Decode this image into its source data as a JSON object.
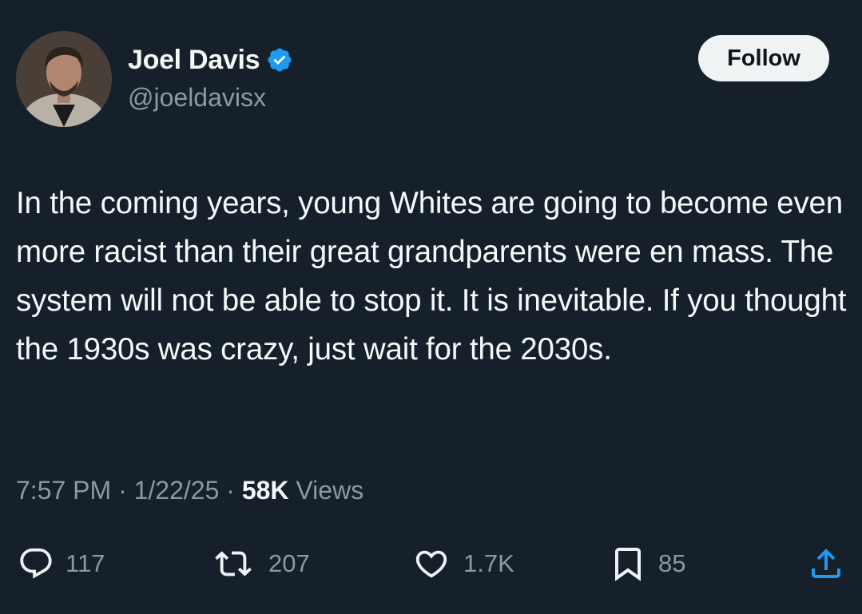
{
  "author": {
    "display_name": "Joel Davis",
    "handle": "@joeldavisx",
    "verified": true,
    "verified_color": "#1d9bf0"
  },
  "follow_button": {
    "label": "Follow"
  },
  "tweet": {
    "text": "In the coming years, young Whites are going to become even more racist than their great grandparents were en mass. The system will not be able to stop it. It is inevitable. If you thought the 1930s was crazy, just wait for the 2030s."
  },
  "meta": {
    "time": "7:57 PM",
    "separator": "·",
    "date": "1/22/25",
    "views_count": "58K",
    "views_label": "Views"
  },
  "actions": {
    "replies": {
      "icon": "reply-icon",
      "count": "117"
    },
    "reposts": {
      "icon": "repost-icon",
      "count": "207"
    },
    "likes": {
      "icon": "heart-icon",
      "count": "1.7K"
    },
    "bookmarks": {
      "icon": "bookmark-icon",
      "count": "85"
    },
    "share": {
      "icon": "share-icon"
    }
  },
  "colors": {
    "background": "#15202b",
    "text_primary": "#f7f9f9",
    "text_secondary": "#8b98a5",
    "button_bg": "#eff3f4"
  }
}
